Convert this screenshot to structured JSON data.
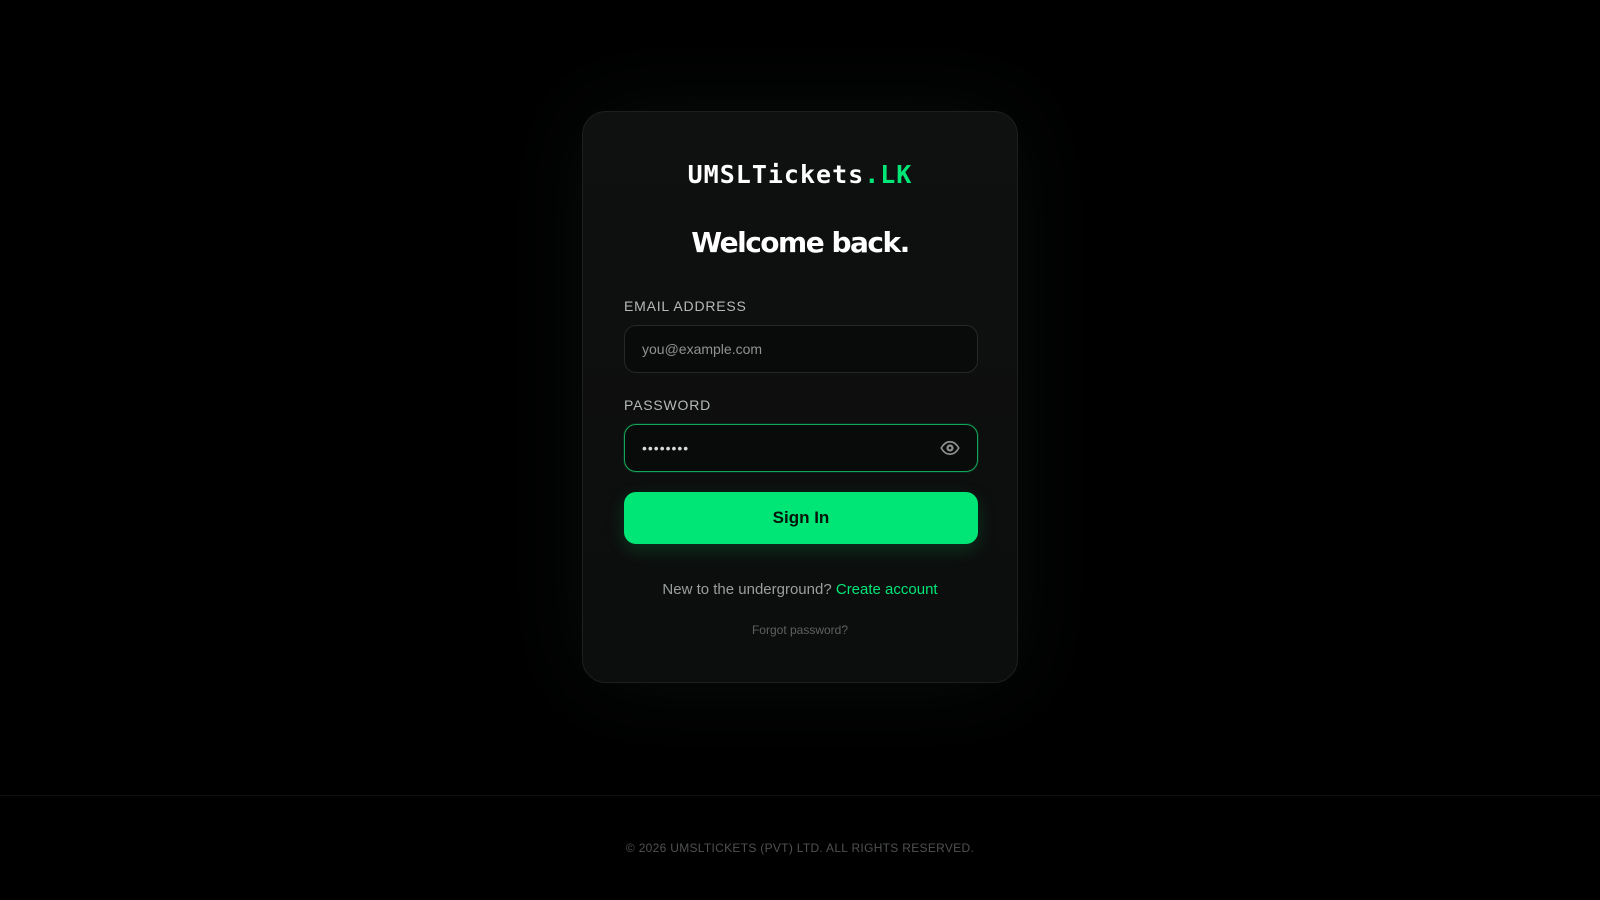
{
  "brand": {
    "name": "UMSLTickets",
    "suffix": ".LK",
    "accent_color": "#00e676"
  },
  "login": {
    "heading": "Welcome back.",
    "email_label": "EMAIL ADDRESS",
    "email_placeholder": "you@example.com",
    "email_value": "",
    "password_label": "PASSWORD",
    "password_value": "••••••••",
    "password_toggle_icon": "eye-icon",
    "signin_label": "Sign In",
    "new_prompt": "New to the underground?",
    "create_account_label": "Create account",
    "forgot_label": "Forgot password?"
  },
  "footer": {
    "copyright": "© 2026 UMSLTICKETS (PVT) LTD. ALL RIGHTS RESERVED."
  }
}
